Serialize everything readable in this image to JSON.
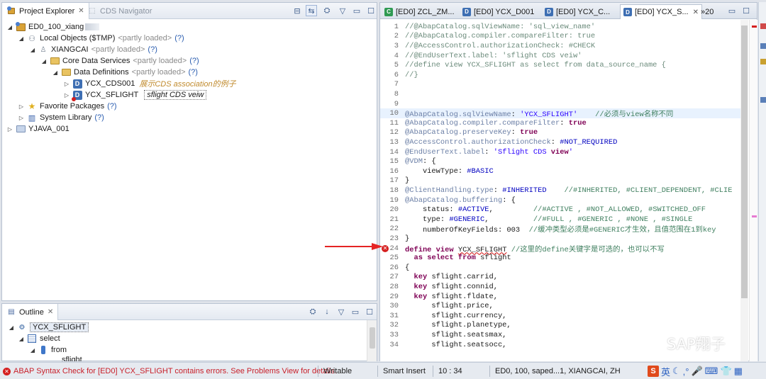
{
  "project_explorer": {
    "tab_label": "Project Explorer",
    "other_tab_label": "CDS Navigator",
    "tree": [
      {
        "label": "ED0_100_xiang"
      },
      {
        "label": "Local Objects ($TMP)",
        "status": "<partly loaded>",
        "help": "(?)"
      },
      {
        "label": "XIANGCAI",
        "status": "<partly loaded>",
        "help": "(?)"
      },
      {
        "label": "Core Data Services",
        "status": "<partly loaded>",
        "help": "(?)"
      },
      {
        "label": "Data Definitions",
        "status": "<partly loaded>",
        "help": "(?)"
      },
      {
        "label": "YCX_CDS001",
        "note": "展示CDS association的例子"
      },
      {
        "label": "YCX_SFLIGHT",
        "note": "sflight CDS veiw"
      },
      {
        "label": "Favorite Packages",
        "help": "(?)"
      },
      {
        "label": "System Library",
        "help": "(?)"
      },
      {
        "label": "YJAVA_001"
      }
    ]
  },
  "outline": {
    "tab_label": "Outline",
    "tree": [
      {
        "label": "YCX_SFLIGHT"
      },
      {
        "label": "select"
      },
      {
        "label": "from"
      },
      {
        "label": "sflight"
      }
    ]
  },
  "editor": {
    "tabs": [
      {
        "label": "[ED0] ZCL_ZM..."
      },
      {
        "label": "[ED0] YCX_D001"
      },
      {
        "label": "[ED0] YCX_C..."
      },
      {
        "label": "[ED0] YCX_S..."
      },
      {
        "label": "»20"
      }
    ],
    "lines": [
      {
        "n": "1",
        "t": "//@AbapCatalog.sqlViewName: 'sql_view_name'"
      },
      {
        "n": "2",
        "t": "//@AbapCatalog.compiler.compareFilter: true"
      },
      {
        "n": "3",
        "t": "//@AccessControl.authorizationCheck: #CHECK"
      },
      {
        "n": "4",
        "t": "//@EndUserText.label: 'sflight CDS veiw'"
      },
      {
        "n": "5",
        "t": "//define view YCX_SFLIGHT as select from data_source_name {"
      },
      {
        "n": "6",
        "t": "//}"
      },
      {
        "n": "7",
        "t": ""
      },
      {
        "n": "8",
        "t": ""
      },
      {
        "n": "9",
        "t": ""
      },
      {
        "n": "10",
        "t": "@AbapCatalog.sqlViewName: 'YCX_SFLIGHT'    //必须与view名称不同"
      },
      {
        "n": "11",
        "t": "@AbapCatalog.compiler.compareFilter: true"
      },
      {
        "n": "12",
        "t": "@AbapCatalog.preserveKey: true"
      },
      {
        "n": "13",
        "t": "@AccessControl.authorizationCheck: #NOT_REQUIRED"
      },
      {
        "n": "14",
        "t": "@EndUserText.label: 'Sflight CDS view'"
      },
      {
        "n": "15",
        "t": "@VDM: {"
      },
      {
        "n": "16",
        "t": "    viewType: #BASIC"
      },
      {
        "n": "17",
        "t": "}"
      },
      {
        "n": "18",
        "t": "@ClientHandling.type: #INHERITED    //#INHERITED, #CLIENT_DEPENDENT, #CLIE"
      },
      {
        "n": "19",
        "t": "@AbapCatalog.buffering: {"
      },
      {
        "n": "20",
        "t": "    status: #ACTIVE,         //#ACTIVE , #NOT_ALLOWED, #SWITCHED_OFF"
      },
      {
        "n": "21",
        "t": "    type: #GENERIC,          //#FULL , #GENERIC , #NONE , #SINGLE"
      },
      {
        "n": "22",
        "t": "    numberOfKeyFields: 003  //缓冲类型必须是#GENERIC才生效，且值范围在1到key"
      },
      {
        "n": "23",
        "t": "}"
      },
      {
        "n": "24",
        "t": "define view YCX_SFLIGHT //这里的define关键字是可选的，也可以不写"
      },
      {
        "n": "25",
        "t": "  as select from sflight"
      },
      {
        "n": "26",
        "t": "{"
      },
      {
        "n": "27",
        "t": "  key sflight.carrid,"
      },
      {
        "n": "28",
        "t": "  key sflight.connid,"
      },
      {
        "n": "29",
        "t": "  key sflight.fldate,"
      },
      {
        "n": "30",
        "t": "      sflight.price,"
      },
      {
        "n": "31",
        "t": "      sflight.currency,"
      },
      {
        "n": "32",
        "t": "      sflight.planetype,"
      },
      {
        "n": "33",
        "t": "      sflight.seatsmax,"
      },
      {
        "n": "34",
        "t": "      sflight.seatsocc,"
      }
    ]
  },
  "status_bar": {
    "error_message": "ABAP Syntax Check for [ED0] YCX_SFLIGHT contains errors. See Problems View for details.",
    "writable": "Writable",
    "insert_mode": "Smart Insert",
    "cursor_position": "10 : 34",
    "system_info": "ED0, 100, saped...1, XIANGCAI, ZH"
  },
  "watermark": {
    "text": "SAP翔子"
  },
  "ime": {
    "logo": "S",
    "char": "英"
  },
  "colors": {
    "error_red": "#d52020",
    "keyword": "#7f0055",
    "comment": "#3f7f5f",
    "string": "#2a00ff",
    "current_line": "#e8f2fe"
  }
}
